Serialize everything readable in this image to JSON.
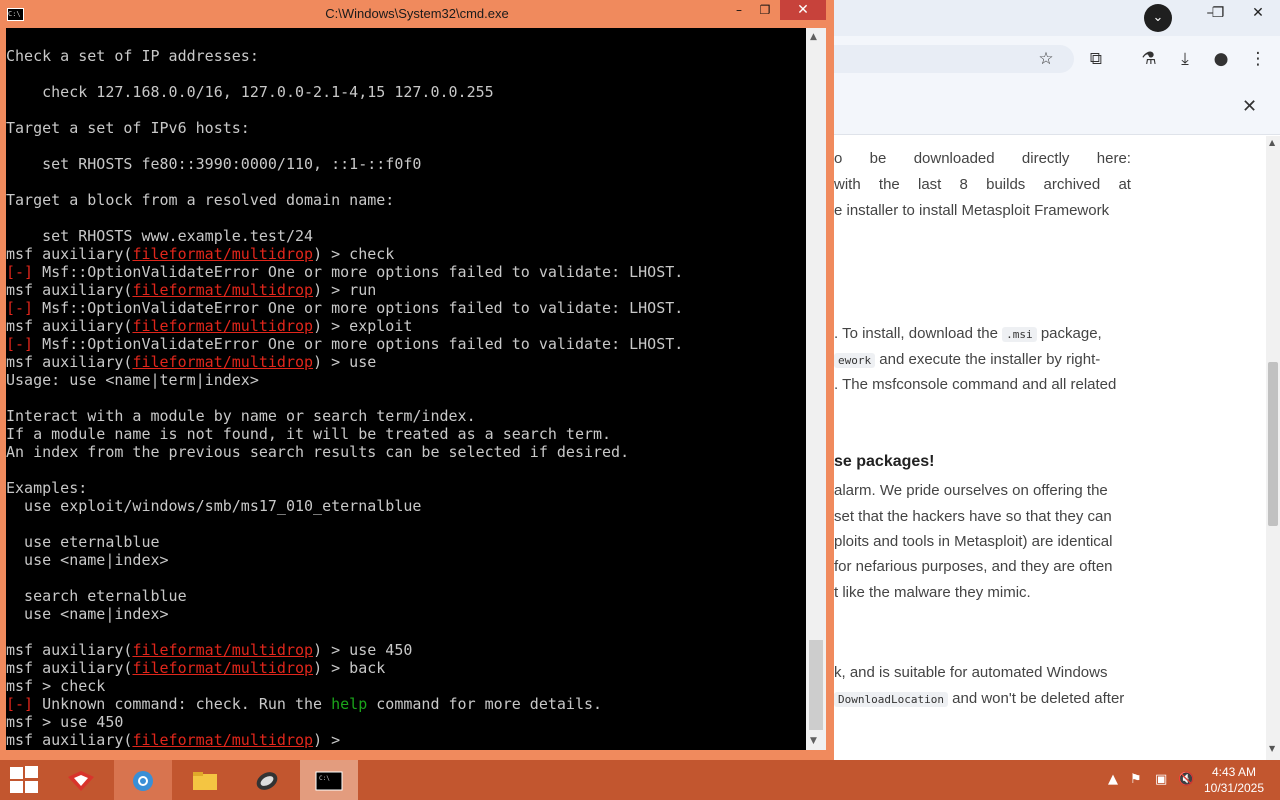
{
  "cmd": {
    "title": "C:\\Windows\\System32\\cmd.exe",
    "lines": [
      [
        {
          "t": "Check a set of IP addresses:"
        }
      ],
      [
        {
          "t": "    check 127.168.0.0/16, 127.0.0-2.1-4,15 127.0.0.255"
        }
      ],
      [
        {
          "t": "Target a set of IPv6 hosts:"
        }
      ],
      [
        {
          "t": "    set RHOSTS fe80::3990:0000/110, ::1-::f0f0"
        }
      ],
      [
        {
          "t": "Target a block from a resolved domain name:"
        }
      ],
      [
        {
          "t": "    set RHOSTS www.example.test/24"
        }
      ],
      [
        {
          "t": "msf auxiliary("
        },
        {
          "t": "fileformat/multidrop",
          "c": "red ul"
        },
        {
          "t": ") > check"
        }
      ],
      [
        {
          "t": "[-]",
          "c": "red"
        },
        {
          "t": " Msf::OptionValidateError One or more options failed to validate: LHOST."
        }
      ],
      [
        {
          "t": "msf auxiliary("
        },
        {
          "t": "fileformat/multidrop",
          "c": "red ul"
        },
        {
          "t": ") > run"
        }
      ],
      [
        {
          "t": "[-]",
          "c": "red"
        },
        {
          "t": " Msf::OptionValidateError One or more options failed to validate: LHOST."
        }
      ],
      [
        {
          "t": "msf auxiliary("
        },
        {
          "t": "fileformat/multidrop",
          "c": "red ul"
        },
        {
          "t": ") > exploit"
        }
      ],
      [
        {
          "t": "[-]",
          "c": "red"
        },
        {
          "t": " Msf::OptionValidateError One or more options failed to validate: LHOST."
        }
      ],
      [
        {
          "t": "msf auxiliary("
        },
        {
          "t": "fileformat/multidrop",
          "c": "red ul"
        },
        {
          "t": ") > use"
        }
      ],
      [
        {
          "t": "Usage: use <name|term|index>"
        }
      ],
      [
        {
          "t": "Interact with a module by name or search term/index."
        }
      ],
      [
        {
          "t": "If a module name is not found, it will be treated as a search term."
        }
      ],
      [
        {
          "t": "An index from the previous search results can be selected if desired."
        }
      ],
      [
        {
          "t": "Examples:"
        }
      ],
      [
        {
          "t": "  use exploit/windows/smb/ms17_010_eternalblue"
        }
      ],
      [
        {
          "t": "  use eternalblue"
        }
      ],
      [
        {
          "t": "  use <name|index>"
        }
      ],
      [
        {
          "t": "  search eternalblue"
        }
      ],
      [
        {
          "t": "  use <name|index>"
        }
      ],
      [
        {
          "t": "msf auxiliary("
        },
        {
          "t": "fileformat/multidrop",
          "c": "red ul"
        },
        {
          "t": ") > use 450"
        }
      ],
      [
        {
          "t": "msf auxiliary("
        },
        {
          "t": "fileformat/multidrop",
          "c": "red ul"
        },
        {
          "t": ") > back"
        }
      ],
      [
        {
          "t": "msf > check"
        }
      ],
      [
        {
          "t": "[-]",
          "c": "red"
        },
        {
          "t": " Unknown command: check. Run the "
        },
        {
          "t": "help",
          "c": "grn"
        },
        {
          "t": " command for more details."
        }
      ],
      [
        {
          "t": "msf > use 450"
        }
      ],
      [
        {
          "t": "msf auxiliary("
        },
        {
          "t": "fileformat/multidrop",
          "c": "red ul"
        },
        {
          "t": ") > "
        }
      ]
    ]
  },
  "browser": {
    "para1": [
      "o",
      "be",
      "downloaded",
      "directly",
      "here:"
    ],
    "para1_l2": [
      "with",
      "the",
      "last",
      "8",
      "builds",
      "archived",
      "at"
    ],
    "para1_l3": "e installer to install Metasploit Framework",
    "para2_l1_a": ". To install, download the ",
    "para2_code1": ".msi",
    "para2_l1_b": " package,",
    "para2_code2": "ework",
    "para2_l2_b": " and execute the installer by right-",
    "para2_l3": ". The msfconsole command and all related",
    "heading": "se packages!",
    "para3": [
      "alarm. We pride ourselves on offering the",
      "set that the hackers have so that they can",
      "ploits and tools in Metasploit) are identical",
      " for nefarious purposes, and they are often",
      "t like the malware they mimic."
    ],
    "para4_l1": "k, and is suitable for automated Windows",
    "para4_code": "DownloadLocation",
    "para4_l2_b": " and won't be deleted after"
  },
  "taskbar": {
    "time": "4:43 AM",
    "date": "10/31/2025"
  },
  "colors": {
    "cmd_frame": "#f08a5d",
    "taskbar": "#c2562f",
    "close_red": "#c7423b",
    "console_red": "#e0261b",
    "console_green": "#1aa51a"
  }
}
